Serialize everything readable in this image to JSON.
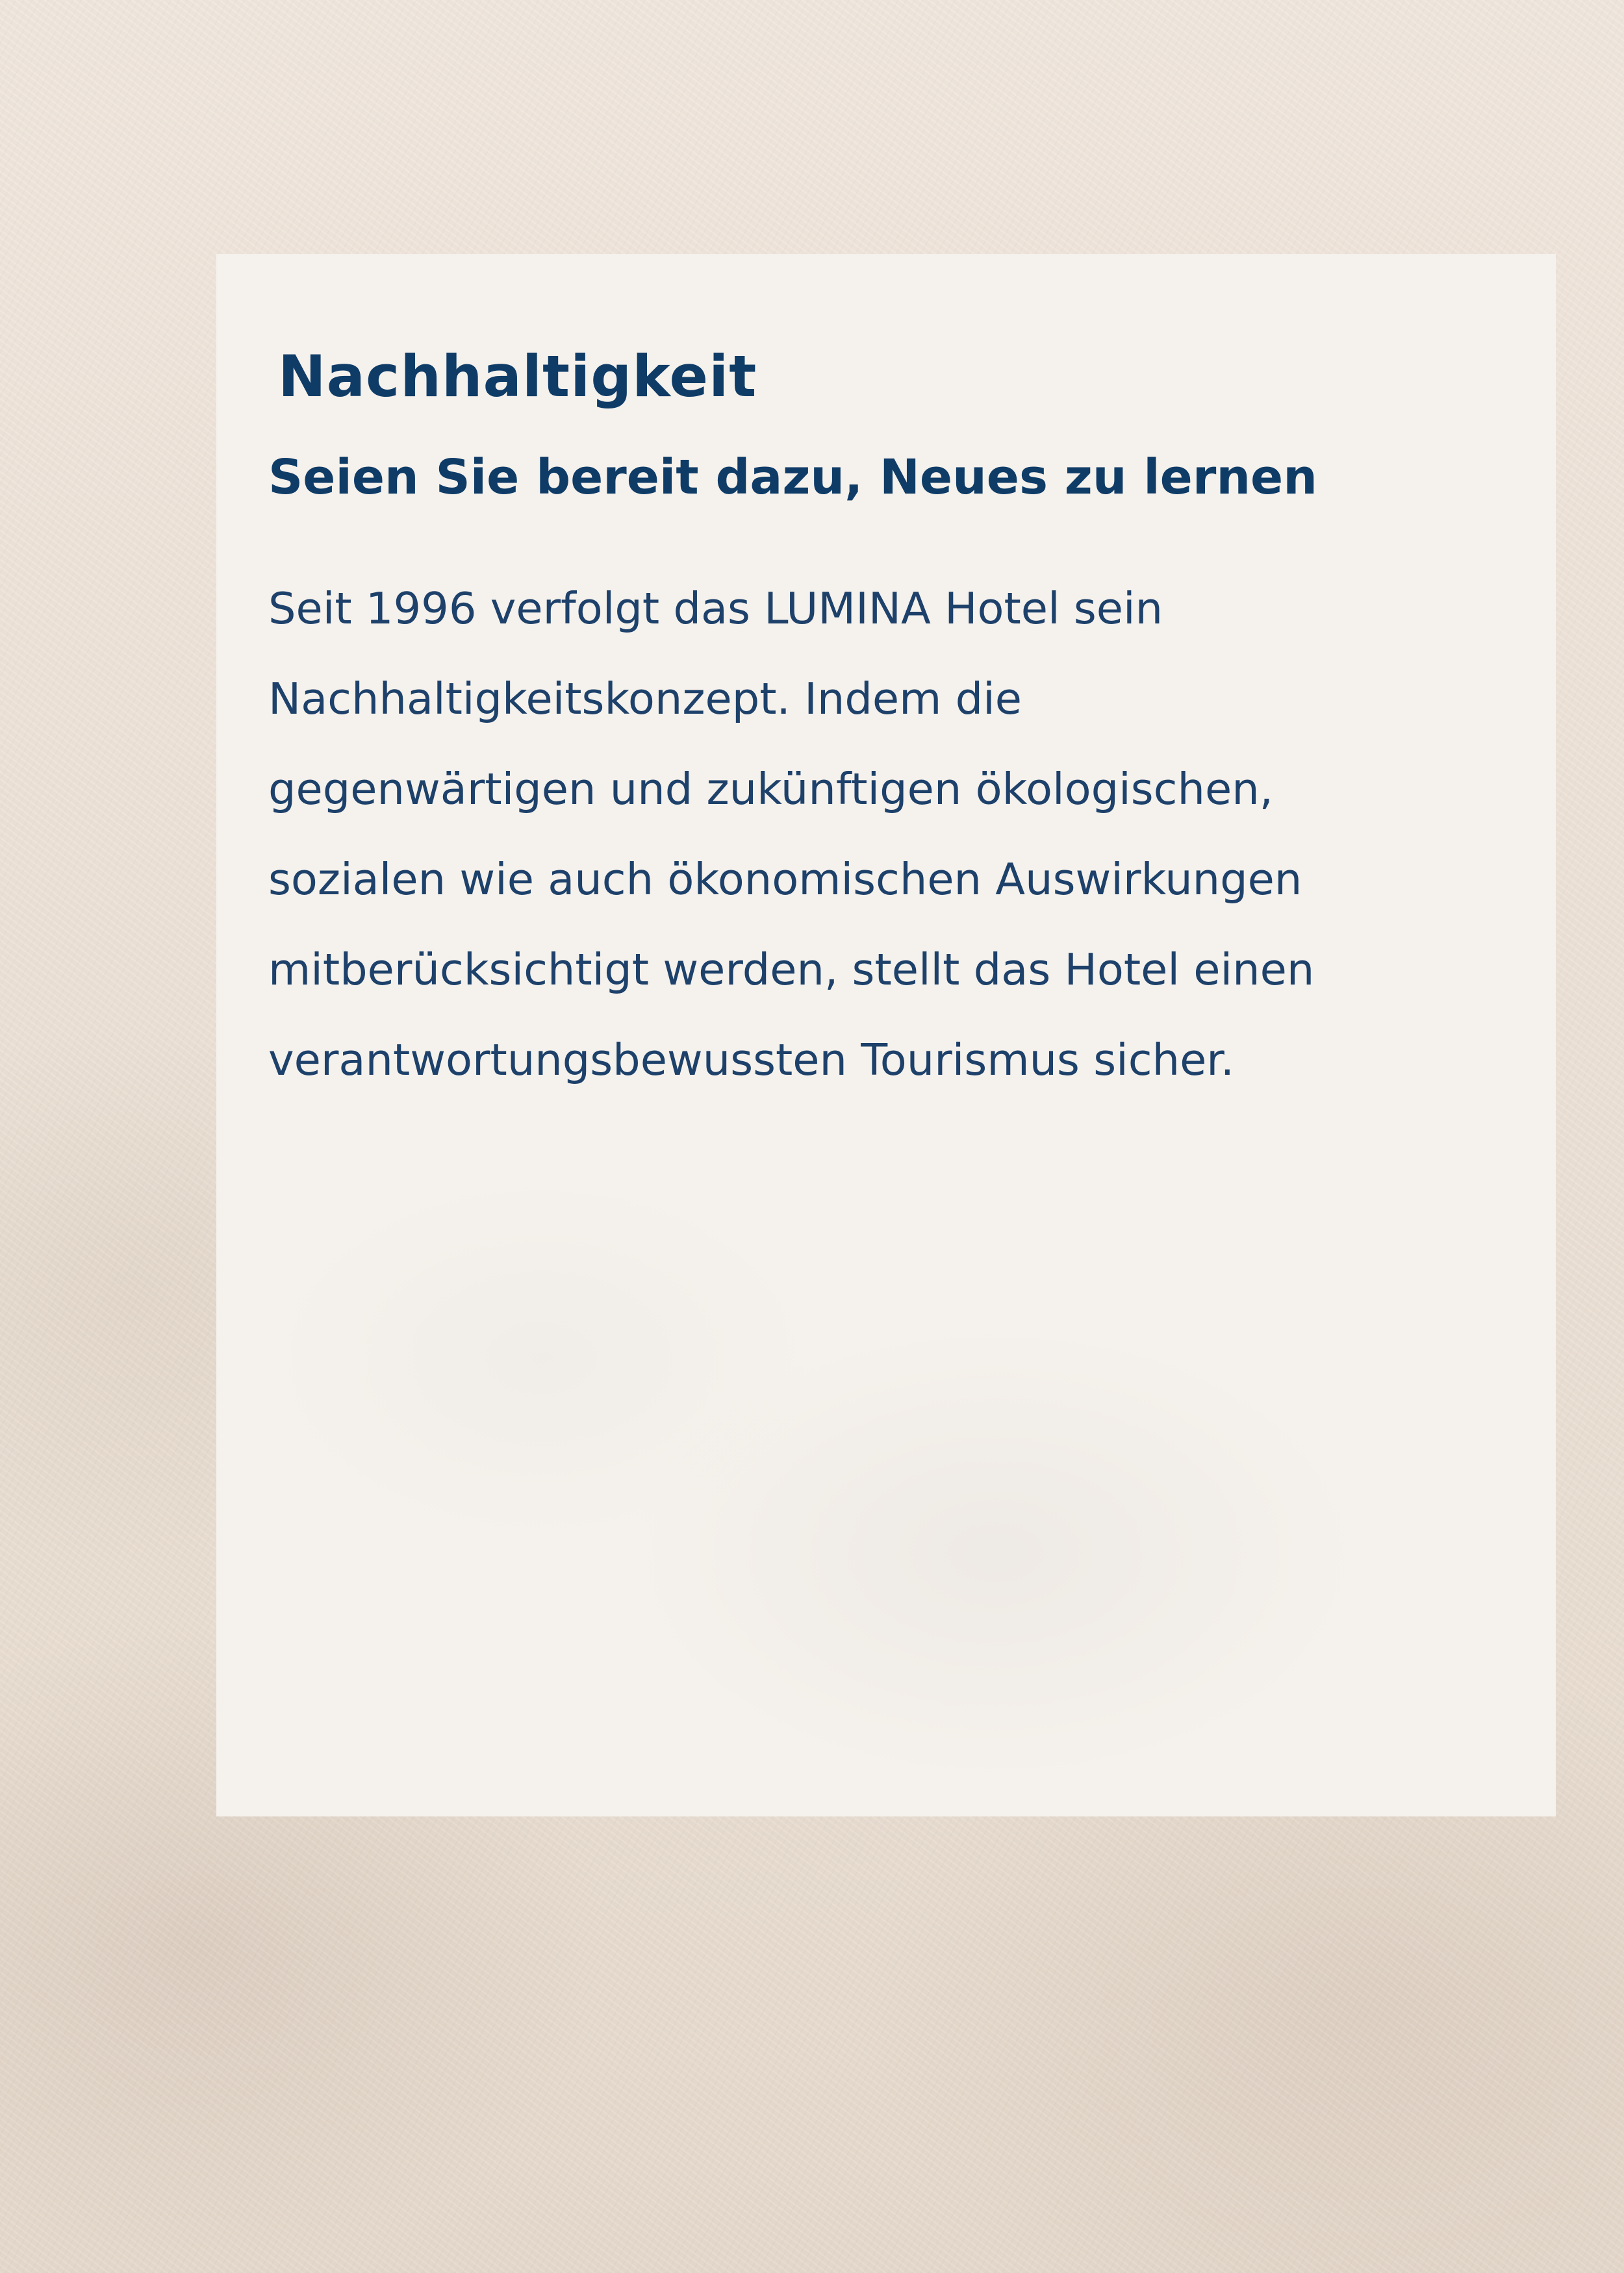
{
  "heading": "Nachhaltigkeit",
  "subheading": "Seien Sie bereit dazu, Neues zu lernen",
  "body_lines": [
    "Seit 1996 verfolgt das LUMINA Hotel sein",
    "Nachhaltigkeitskonzept. Indem die",
    "gegenwärtigen und zukünftigen ökologischen,",
    "sozialen wie auch ökonomischen Auswirkungen",
    "mitberücksichtigt werden, stellt das Hotel einen",
    "verantwortungsbewussten Tourismus sicher."
  ],
  "colors": {
    "heading": "#0f3c67",
    "body": "#1d416a",
    "panel": "#f5f1ec",
    "background": "#ece1d6"
  }
}
